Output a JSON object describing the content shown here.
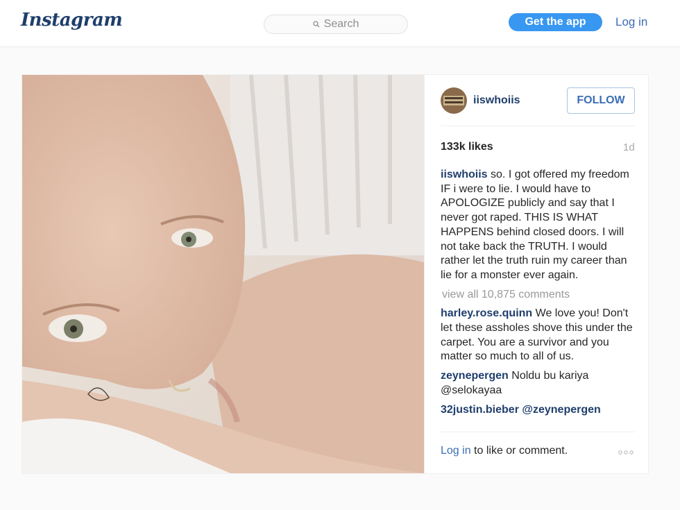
{
  "header": {
    "logo": "Instagram",
    "search_placeholder": "Search",
    "get_app_label": "Get the app",
    "login_label": "Log in"
  },
  "post": {
    "username": "iiswhoiis",
    "follow_label": "FOLLOW",
    "likes": "133k likes",
    "age": "1d",
    "caption": "so. I got offered my freedom IF i were to lie. I would have to APOLOGIZE publicly and say that I never got raped. THIS IS WHAT HAPPENS behind closed doors. I will not take back the TRUTH. I would rather let the truth ruin my career than lie for a monster ever again.",
    "view_all_comments": "view all 10,875 comments",
    "comments": [
      {
        "user": "harley.rose.quinn",
        "text": "We love you! Don't let these assholes shove this under the carpet. You are a survivor and you matter so much to all of us."
      },
      {
        "user": "zeynepergen",
        "text": "Noldu bu kariya @selokayaa"
      },
      {
        "user": "32justin.bieber",
        "text": "@zeynepergen"
      }
    ],
    "footer_login": "Log in",
    "footer_text": " to like or comment."
  },
  "icons": {
    "search": "search-icon",
    "more": "more-options-icon"
  },
  "colors": {
    "accent": "#3897f0",
    "link": "#3b6db5",
    "username": "#1f3e6c"
  }
}
